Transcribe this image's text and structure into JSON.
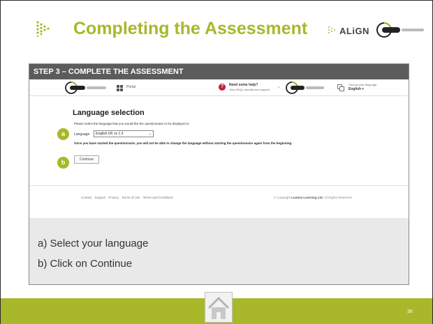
{
  "slide": {
    "title": "Completing the Assessment",
    "align_logo_text": "ALiGN",
    "page_number": "36"
  },
  "panel": {
    "step_title": "STEP 3 – COMPLETE THE ASSESSMENT",
    "instructions": [
      "a)  Select your language",
      "b)  Click on Continue"
    ]
  },
  "webpage": {
    "header": {
      "portal_label": "Portal",
      "help_title": "Need some help?",
      "help_sub": "View FAQs, tutorials and support",
      "choose_language_label": "Choose your language:",
      "current_language": "English ▾"
    },
    "heading": "Language selection",
    "description": "Please select the language that you would like the questionnaire to be displayed in:",
    "language_field_label": "Language",
    "language_selected": "English UK vs 1.3",
    "warning": "Once you have started the questionnaire, you will not be able to change the language without starting the questionnaire again from the beginning.",
    "continue_label": "Continue",
    "badges": {
      "a": "a",
      "b": "b"
    },
    "footer_links": [
      "Contact",
      "Support",
      "Privacy",
      "Terms of Use",
      "Terms and Conditions"
    ],
    "copyright_prefix": "© Copyright",
    "copyright_company": "Lumina Learning Ltd.",
    "copyright_suffix": "All Rights Reserved"
  },
  "colors": {
    "accent_green": "#a8b82a",
    "step_bar": "#5c5c5c",
    "help_red": "#c0203a"
  }
}
